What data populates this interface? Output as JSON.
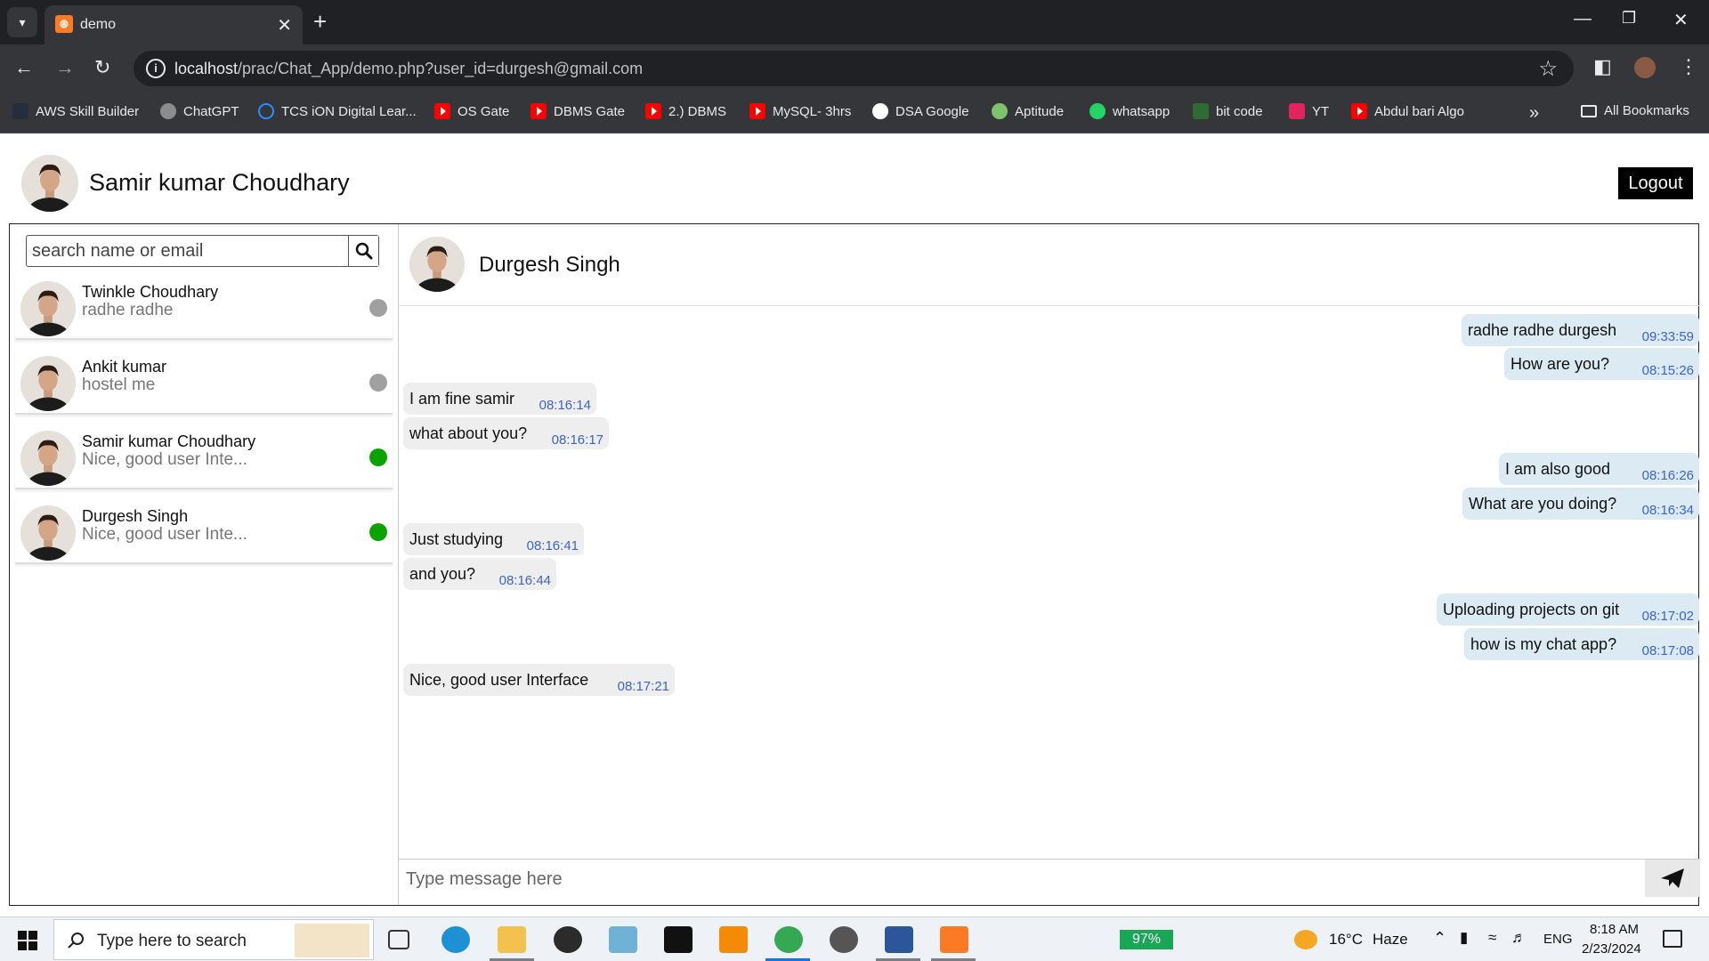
{
  "browser": {
    "tab_title": "demo",
    "url_host": "localhost",
    "url_path": "/prac/Chat_App/demo.php?user_id=durgesh@gmail.com",
    "bookmarks": [
      {
        "label": "AWS Skill Builder",
        "icon": "aws-icon"
      },
      {
        "label": "ChatGPT",
        "icon": "chatgpt-icon"
      },
      {
        "label": "TCS iON Digital Lear...",
        "icon": "tcs-icon"
      },
      {
        "label": "OS Gate",
        "icon": "youtube-icon"
      },
      {
        "label": "DBMS Gate",
        "icon": "youtube-icon"
      },
      {
        "label": "2.) DBMS",
        "icon": "youtube-icon"
      },
      {
        "label": "MySQL- 3hrs",
        "icon": "youtube-icon"
      },
      {
        "label": "DSA Google",
        "icon": "google-icon"
      },
      {
        "label": "Aptitude",
        "icon": "aptitude-icon"
      },
      {
        "label": "whatsapp",
        "icon": "whatsapp-icon"
      },
      {
        "label": "bit code",
        "icon": "code-icon"
      },
      {
        "label": "YT",
        "icon": "yt-icon"
      },
      {
        "label": "Abdul bari Algo",
        "icon": "youtube-icon"
      }
    ],
    "all_bookmarks": "All Bookmarks"
  },
  "app": {
    "current_user": "Samir kumar Choudhary",
    "logout_label": "Logout",
    "search_placeholder": "search name or email",
    "contacts": [
      {
        "name": "Twinkle Choudhary",
        "last": "radhe radhe",
        "online": false
      },
      {
        "name": "Ankit kumar",
        "last": "hostel me",
        "online": false
      },
      {
        "name": "Samir kumar Choudhary",
        "last": "Nice, good user Inte...",
        "online": true
      },
      {
        "name": "Durgesh Singh",
        "last": "Nice, good user Inte...",
        "online": true
      }
    ],
    "chat_partner": "Durgesh Singh",
    "messages": [
      {
        "text": "radhe radhe durgesh",
        "time": "09:33:59",
        "dir": "out"
      },
      {
        "text": "How are you?",
        "time": "08:15:26",
        "dir": "out"
      },
      {
        "text": "I am fine samir",
        "time": "08:16:14",
        "dir": "in"
      },
      {
        "text": "what about you?",
        "time": "08:16:17",
        "dir": "in"
      },
      {
        "text": "I am also good",
        "time": "08:16:26",
        "dir": "out"
      },
      {
        "text": "What are you doing?",
        "time": "08:16:34",
        "dir": "out"
      },
      {
        "text": "Just studying",
        "time": "08:16:41",
        "dir": "in"
      },
      {
        "text": "and you?",
        "time": "08:16:44",
        "dir": "in"
      },
      {
        "text": "Uploading projects on git",
        "time": "08:17:02",
        "dir": "out"
      },
      {
        "text": "how is my chat app?",
        "time": "08:17:08",
        "dir": "out"
      },
      {
        "text": "Nice, good user Interface",
        "time": "08:17:21",
        "dir": "in"
      }
    ],
    "composer_placeholder": "Type message here",
    "colors": {
      "online": "#0aa300",
      "offline": "#a0a0a0",
      "outgoing": "#dbeaf3",
      "incoming": "#eeeeee",
      "timestamp": "#3c64c8"
    }
  },
  "taskbar": {
    "search_placeholder": "Type here to search",
    "battery": "97%",
    "weather_temp": "16°C",
    "weather_desc": "Haze",
    "language": "ENG",
    "time": "8:18 AM",
    "date": "2/23/2024"
  }
}
